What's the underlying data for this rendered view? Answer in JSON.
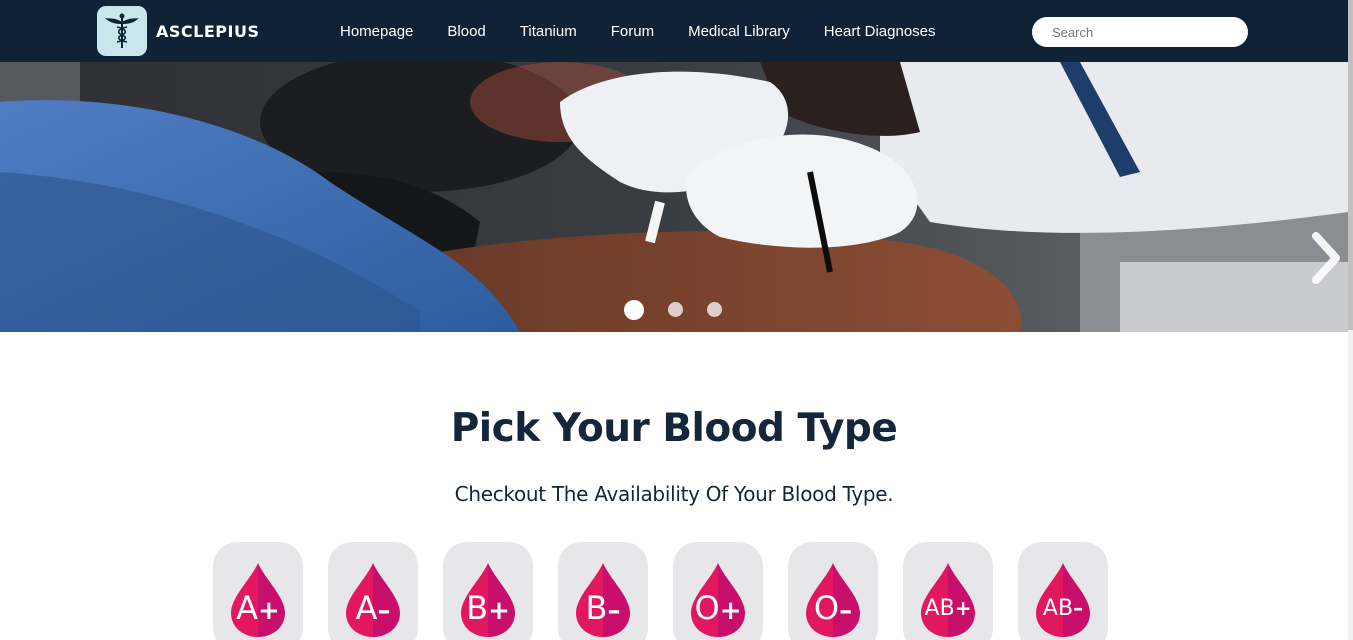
{
  "navbar": {
    "brand_name": "ASCLEPIUS",
    "logo_icon": "caduceus-icon",
    "links": [
      "Homepage",
      "Blood",
      "Titanium",
      "Forum",
      "Medical Library",
      "Heart Diagnoses"
    ],
    "search_placeholder": "Search",
    "background_color": "#0f2236"
  },
  "hero": {
    "image_subject": "blood-draw-photo",
    "next_icon": "chevron-right-icon",
    "slides_total": 3,
    "active_slide": 1
  },
  "section": {
    "title": "Pick Your Blood Type",
    "subtitle": "Checkout The Availability Of Your Blood Type."
  },
  "blood_types": [
    {
      "label": "A",
      "sign": "+"
    },
    {
      "label": "A",
      "sign": "–"
    },
    {
      "label": "B",
      "sign": "+"
    },
    {
      "label": "B",
      "sign": "–"
    },
    {
      "label": "O",
      "sign": "+"
    },
    {
      "label": "O",
      "sign": "–"
    },
    {
      "label": "AB",
      "sign": "+"
    },
    {
      "label": "AB",
      "sign": "–"
    }
  ],
  "colors": {
    "drop_left": "#e2175f",
    "drop_right": "#c70f6b",
    "card_bg": "#e7e7e9",
    "title_text": "#15263b"
  }
}
